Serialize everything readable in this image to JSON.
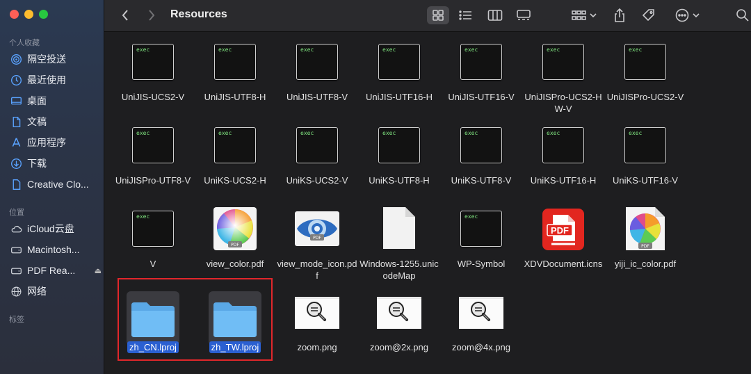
{
  "window": {
    "title": "Resources"
  },
  "sidebar": {
    "favorites_label": "个人收藏",
    "favorites": [
      {
        "label": "隔空投送",
        "icon": "airdrop-icon"
      },
      {
        "label": "最近使用",
        "icon": "recents-icon"
      },
      {
        "label": "桌面",
        "icon": "desktop-icon"
      },
      {
        "label": "文稿",
        "icon": "documents-icon"
      },
      {
        "label": "应用程序",
        "icon": "applications-icon"
      },
      {
        "label": "下载",
        "icon": "downloads-icon"
      },
      {
        "label": "Creative Clo...",
        "icon": "document-icon"
      }
    ],
    "locations_label": "位置",
    "locations": [
      {
        "label": "iCloud云盘",
        "icon": "icloud-icon"
      },
      {
        "label": "Macintosh...",
        "icon": "disk-icon"
      },
      {
        "label": "PDF Rea...",
        "icon": "disk-icon"
      },
      {
        "label": "网络",
        "icon": "network-icon"
      }
    ],
    "tags_label": "标签"
  },
  "files": [
    {
      "name": "UniJIS-UCS2-V",
      "type": "exec",
      "badge": "exec"
    },
    {
      "name": "UniJIS-UTF8-H",
      "type": "exec",
      "badge": "exec"
    },
    {
      "name": "UniJIS-UTF8-V",
      "type": "exec",
      "badge": "exec"
    },
    {
      "name": "UniJIS-UTF16-H",
      "type": "exec",
      "badge": "exec"
    },
    {
      "name": "UniJIS-UTF16-V",
      "type": "exec",
      "badge": "exec"
    },
    {
      "name": "UniJISPro-UCS2-HW-V",
      "type": "exec",
      "badge": "exec"
    },
    {
      "name": "UniJISPro-UCS2-V",
      "type": "exec",
      "badge": "exec"
    },
    {
      "name": "UniJISPro-UTF8-V",
      "type": "exec",
      "badge": "exec"
    },
    {
      "name": "UniKS-UCS2-H",
      "type": "exec",
      "badge": "exec"
    },
    {
      "name": "UniKS-UCS2-V",
      "type": "exec",
      "badge": "exec"
    },
    {
      "name": "UniKS-UTF8-H",
      "type": "exec",
      "badge": "exec"
    },
    {
      "name": "UniKS-UTF8-V",
      "type": "exec",
      "badge": "exec"
    },
    {
      "name": "UniKS-UTF16-H",
      "type": "exec",
      "badge": "exec"
    },
    {
      "name": "UniKS-UTF16-V",
      "type": "exec",
      "badge": "exec"
    },
    {
      "name": "V",
      "type": "exec",
      "badge": "exec"
    },
    {
      "name": "view_color.pdf",
      "type": "colorpdf",
      "badge": "PDF"
    },
    {
      "name": "view_mode_icon.pdf",
      "type": "eyepdf",
      "badge": "PDF"
    },
    {
      "name": "Windows-1255.unicodeMap",
      "type": "blank"
    },
    {
      "name": "WP-Symbol",
      "type": "exec",
      "badge": "exec"
    },
    {
      "name": "XDVDocument.icns",
      "type": "redpdf",
      "badge": "PDF"
    },
    {
      "name": "yiji_ic_color.pdf",
      "type": "colorpdf2",
      "badge": "PDF"
    },
    {
      "name": "zh_CN.lproj",
      "type": "folder",
      "selected": true
    },
    {
      "name": "zh_TW.lproj",
      "type": "folder",
      "selected": true
    },
    {
      "name": "zoom.png",
      "type": "zoom"
    },
    {
      "name": "zoom@2x.png",
      "type": "zoom"
    },
    {
      "name": "zoom@4x.png",
      "type": "zoom"
    }
  ]
}
